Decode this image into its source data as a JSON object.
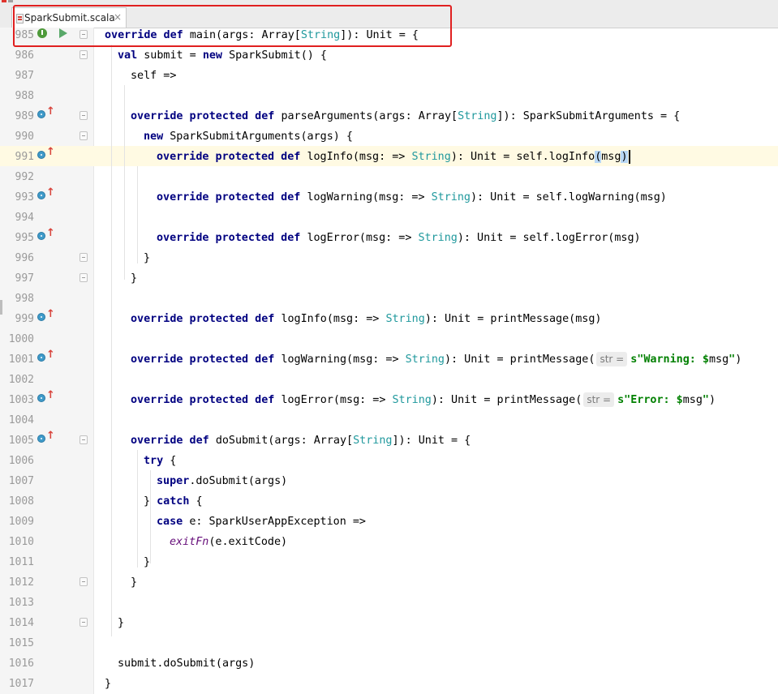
{
  "tab": {
    "filename": "SparkSubmit.scala",
    "close": "×"
  },
  "lines": [
    {
      "num": "985",
      "segs": [
        [
          "kw",
          "override def "
        ],
        [
          "",
          "main(args: Array["
        ],
        [
          "ty",
          "String"
        ],
        [
          "",
          "]): Unit = {"
        ]
      ]
    },
    {
      "num": "986",
      "segs": [
        [
          "kw",
          "val "
        ],
        [
          "",
          "submit = "
        ],
        [
          "kw",
          "new "
        ],
        [
          "",
          "SparkSubmit() {"
        ]
      ]
    },
    {
      "num": "987",
      "segs": [
        [
          "",
          "self =>"
        ]
      ]
    },
    {
      "num": "988",
      "segs": []
    },
    {
      "num": "989",
      "segs": [
        [
          "kw",
          "override protected def "
        ],
        [
          "",
          "parseArguments(args: Array["
        ],
        [
          "ty",
          "String"
        ],
        [
          "",
          "]): SparkSubmitArguments = {"
        ]
      ]
    },
    {
      "num": "990",
      "segs": [
        [
          "kw",
          "new "
        ],
        [
          "",
          "SparkSubmitArguments(args) {"
        ]
      ]
    },
    {
      "num": "991",
      "segs": [
        [
          "kw",
          "override protected def "
        ],
        [
          "",
          "logInfo(msg: => "
        ],
        [
          "ty",
          "String"
        ],
        [
          "",
          "): Unit = self.logInfo"
        ],
        [
          "sel",
          "("
        ],
        [
          "",
          "msg"
        ],
        [
          "sel",
          ")"
        ],
        [
          "caret",
          ""
        ]
      ]
    },
    {
      "num": "992",
      "segs": []
    },
    {
      "num": "993",
      "segs": [
        [
          "kw",
          "override protected def "
        ],
        [
          "",
          "logWarning(msg: => "
        ],
        [
          "ty",
          "String"
        ],
        [
          "",
          "): Unit = self.logWarning(msg)"
        ]
      ]
    },
    {
      "num": "994",
      "segs": []
    },
    {
      "num": "995",
      "segs": [
        [
          "kw",
          "override protected def "
        ],
        [
          "",
          "logError(msg: => "
        ],
        [
          "ty",
          "String"
        ],
        [
          "",
          "): Unit = self.logError(msg)"
        ]
      ]
    },
    {
      "num": "996",
      "segs": [
        [
          "",
          "}"
        ]
      ]
    },
    {
      "num": "997",
      "segs": [
        [
          "",
          "}"
        ]
      ]
    },
    {
      "num": "998",
      "segs": []
    },
    {
      "num": "999",
      "segs": [
        [
          "kw",
          "override protected def "
        ],
        [
          "",
          "logInfo(msg: => "
        ],
        [
          "ty",
          "String"
        ],
        [
          "",
          "): Unit = printMessage(msg)"
        ]
      ]
    },
    {
      "num": "1000",
      "segs": []
    },
    {
      "num": "1001",
      "segs": [
        [
          "kw",
          "override protected def "
        ],
        [
          "",
          "logWarning(msg: => "
        ],
        [
          "ty",
          "String"
        ],
        [
          "",
          "): Unit = printMessage("
        ],
        [
          "hint",
          "str ="
        ],
        [
          "str",
          "s\"Warning: $"
        ],
        [
          "",
          "msg"
        ],
        [
          "str",
          "\""
        ],
        [
          "",
          ")"
        ]
      ]
    },
    {
      "num": "1002",
      "segs": []
    },
    {
      "num": "1003",
      "segs": [
        [
          "kw",
          "override protected def "
        ],
        [
          "",
          "logError(msg: => "
        ],
        [
          "ty",
          "String"
        ],
        [
          "",
          "): Unit = printMessage("
        ],
        [
          "hint",
          "str ="
        ],
        [
          "str",
          "s\"Error: $"
        ],
        [
          "",
          "msg"
        ],
        [
          "str",
          "\""
        ],
        [
          "",
          ")"
        ]
      ]
    },
    {
      "num": "1004",
      "segs": []
    },
    {
      "num": "1005",
      "segs": [
        [
          "kw",
          "override def "
        ],
        [
          "",
          "doSubmit(args: Array["
        ],
        [
          "ty",
          "String"
        ],
        [
          "",
          "]): Unit = {"
        ]
      ]
    },
    {
      "num": "1006",
      "segs": [
        [
          "kw",
          "try "
        ],
        [
          "",
          "{"
        ]
      ]
    },
    {
      "num": "1007",
      "segs": [
        [
          "kw",
          "super"
        ],
        [
          "",
          ".doSubmit(args)"
        ]
      ]
    },
    {
      "num": "1008",
      "segs": [
        [
          "",
          "} "
        ],
        [
          "kw",
          "catch "
        ],
        [
          "",
          "{"
        ]
      ]
    },
    {
      "num": "1009",
      "segs": [
        [
          "kw",
          "case "
        ],
        [
          "",
          "e: SparkUserAppException =>"
        ]
      ]
    },
    {
      "num": "1010",
      "segs": [
        [
          "fn",
          "exitFn"
        ],
        [
          "",
          "(e.exitCode)"
        ]
      ]
    },
    {
      "num": "1011",
      "segs": [
        [
          "",
          "}"
        ]
      ]
    },
    {
      "num": "1012",
      "segs": [
        [
          "",
          "}"
        ]
      ]
    },
    {
      "num": "1013",
      "segs": []
    },
    {
      "num": "1014",
      "segs": [
        [
          "",
          "}"
        ]
      ]
    },
    {
      "num": "1015",
      "segs": []
    },
    {
      "num": "1016",
      "segs": [
        [
          "",
          "submit.doSubmit(args)"
        ]
      ]
    },
    {
      "num": "1017",
      "segs": [
        [
          "",
          "}"
        ]
      ]
    }
  ],
  "colors": {
    "keyword": "#000080",
    "type": "#20999d",
    "string": "#008000",
    "italic_fn": "#660e7a",
    "current_line": "#fffae3",
    "highlight_box": "#e02020"
  },
  "icons": {
    "override": "overridden-method-icon",
    "up": "go-to-super-icon",
    "implements": "implementing-method-icon",
    "run": "run-icon",
    "fold": "fold-icon"
  }
}
